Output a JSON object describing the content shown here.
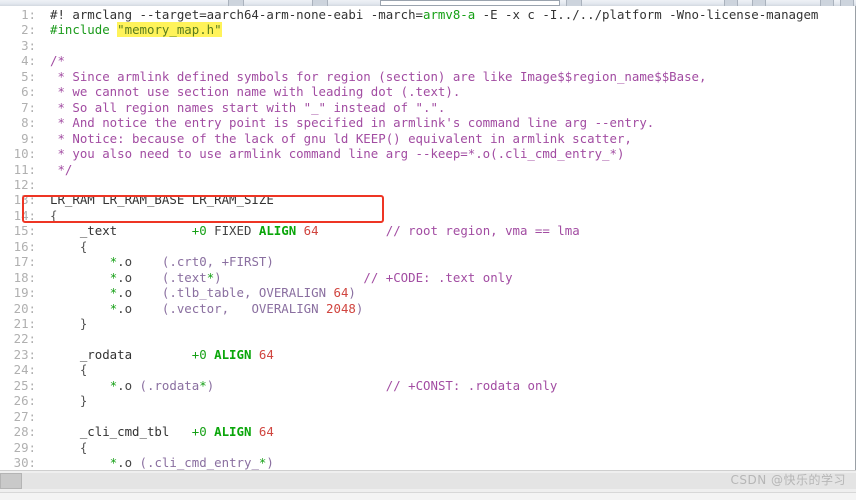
{
  "app": {
    "watermark": "CSDN @快乐的学习"
  },
  "toolbar": {
    "visible": true,
    "note": "clipped toolbar strip"
  },
  "editor": {
    "first_line_number": 1,
    "last_line_number": 30,
    "gutter_color": "#b0b0b0",
    "background": "#ffffff",
    "search_highlight_color": "#fff35a",
    "annotation_box_color": "#ee3524"
  },
  "lines": [
    {
      "n": "1",
      "tokens": [
        {
          "t": "#! armclang --target=aarch64-arm-none-eabi -march=",
          "c": "t-plain"
        },
        {
          "t": "armv8-a",
          "c": "t-green"
        },
        {
          "t": " -E -x c -I../../platform -Wno-license-managem",
          "c": "t-plain"
        }
      ]
    },
    {
      "n": "2",
      "tokens": [
        {
          "t": "#include",
          "c": "t-pre"
        },
        {
          "t": " ",
          "c": "t-plain"
        },
        {
          "t": "\"memory_map.h\"",
          "c": "t-str t-hl"
        }
      ]
    },
    {
      "n": "3",
      "tokens": []
    },
    {
      "n": "4",
      "tokens": [
        {
          "t": "/*",
          "c": "t-comment"
        }
      ]
    },
    {
      "n": "5",
      "tokens": [
        {
          "t": " * Since armlink defined symbols for region (section) are like Image$$region_name$$Base,",
          "c": "t-comment"
        }
      ]
    },
    {
      "n": "6",
      "tokens": [
        {
          "t": " * we cannot use section name with leading dot (.text).",
          "c": "t-comment"
        }
      ]
    },
    {
      "n": "7",
      "tokens": [
        {
          "t": " * So all region names start with \"_\" instead of \".\".",
          "c": "t-comment"
        }
      ]
    },
    {
      "n": "8",
      "tokens": [
        {
          "t": " * And notice the entry point is specified in armlink's command line arg --entry.",
          "c": "t-comment"
        }
      ]
    },
    {
      "n": "9",
      "tokens": [
        {
          "t": " * Notice: because of the lack of gnu ld KEEP() equivalent in armlink scatter,",
          "c": "t-comment"
        }
      ]
    },
    {
      "n": "10",
      "tokens": [
        {
          "t": " * you also need to use armlink command line arg --keep=*.o(.cli_cmd_entry_*)",
          "c": "t-comment"
        }
      ]
    },
    {
      "n": "11",
      "tokens": [
        {
          "t": " */",
          "c": "t-comment"
        }
      ]
    },
    {
      "n": "12",
      "tokens": []
    },
    {
      "n": "13",
      "tokens": [
        {
          "t": "LR_RAM ",
          "c": "t-plain"
        },
        {
          "t": "LR_RAM_BASE LR_RAM_SIZE",
          "c": "t-red"
        }
      ]
    },
    {
      "n": "14",
      "tokens": [
        {
          "t": "{",
          "c": "t-bk"
        }
      ]
    },
    {
      "n": "15",
      "tokens": [
        {
          "t": "    _text          ",
          "c": "t-plain"
        },
        {
          "t": "+0",
          "c": "t-green"
        },
        {
          "t": " FIXED ",
          "c": "t-dark"
        },
        {
          "t": "ALIGN",
          "c": "t-kw"
        },
        {
          "t": " ",
          "c": "t-plain"
        },
        {
          "t": "64",
          "c": "t-num"
        },
        {
          "t": "         ",
          "c": "t-plain"
        },
        {
          "t": "// root region, vma == lma",
          "c": "t-comment"
        }
      ]
    },
    {
      "n": "16",
      "tokens": [
        {
          "t": "    {",
          "c": "t-bk"
        }
      ]
    },
    {
      "n": "17",
      "tokens": [
        {
          "t": "        ",
          "c": "t-plain"
        },
        {
          "t": "*",
          "c": "t-green"
        },
        {
          "t": ".o",
          "c": "t-dark"
        },
        {
          "t": "    ",
          "c": "t-plain"
        },
        {
          "t": "(.crt0, +FIRST)",
          "c": "t-paren"
        }
      ]
    },
    {
      "n": "18",
      "tokens": [
        {
          "t": "        ",
          "c": "t-plain"
        },
        {
          "t": "*",
          "c": "t-green"
        },
        {
          "t": ".o",
          "c": "t-dark"
        },
        {
          "t": "    ",
          "c": "t-plain"
        },
        {
          "t": "(.text",
          "c": "t-paren"
        },
        {
          "t": "*",
          "c": "t-green"
        },
        {
          "t": ")",
          "c": "t-paren"
        },
        {
          "t": "                   ",
          "c": "t-plain"
        },
        {
          "t": "// +CODE: .text only",
          "c": "t-comment"
        }
      ]
    },
    {
      "n": "19",
      "tokens": [
        {
          "t": "        ",
          "c": "t-plain"
        },
        {
          "t": "*",
          "c": "t-green"
        },
        {
          "t": ".o",
          "c": "t-dark"
        },
        {
          "t": "    ",
          "c": "t-plain"
        },
        {
          "t": "(.tlb_table, OVERALIGN ",
          "c": "t-paren"
        },
        {
          "t": "64",
          "c": "t-num"
        },
        {
          "t": ")",
          "c": "t-paren"
        }
      ]
    },
    {
      "n": "20",
      "tokens": [
        {
          "t": "        ",
          "c": "t-plain"
        },
        {
          "t": "*",
          "c": "t-green"
        },
        {
          "t": ".o",
          "c": "t-dark"
        },
        {
          "t": "    ",
          "c": "t-plain"
        },
        {
          "t": "(.vector,   OVERALIGN ",
          "c": "t-paren"
        },
        {
          "t": "2048",
          "c": "t-num"
        },
        {
          "t": ")",
          "c": "t-paren"
        }
      ]
    },
    {
      "n": "21",
      "tokens": [
        {
          "t": "    }",
          "c": "t-bk"
        }
      ]
    },
    {
      "n": "22",
      "tokens": []
    },
    {
      "n": "23",
      "tokens": [
        {
          "t": "    _rodata        ",
          "c": "t-plain"
        },
        {
          "t": "+0",
          "c": "t-green"
        },
        {
          "t": " ",
          "c": "t-plain"
        },
        {
          "t": "ALIGN",
          "c": "t-kw"
        },
        {
          "t": " ",
          "c": "t-plain"
        },
        {
          "t": "64",
          "c": "t-num"
        }
      ]
    },
    {
      "n": "24",
      "tokens": [
        {
          "t": "    {",
          "c": "t-bk"
        }
      ]
    },
    {
      "n": "25",
      "tokens": [
        {
          "t": "        ",
          "c": "t-plain"
        },
        {
          "t": "*",
          "c": "t-green"
        },
        {
          "t": ".o ",
          "c": "t-dark"
        },
        {
          "t": "(.rodata",
          "c": "t-paren"
        },
        {
          "t": "*",
          "c": "t-green"
        },
        {
          "t": ")",
          "c": "t-paren"
        },
        {
          "t": "                       ",
          "c": "t-plain"
        },
        {
          "t": "// +CONST: .rodata only",
          "c": "t-comment"
        }
      ]
    },
    {
      "n": "26",
      "tokens": [
        {
          "t": "    }",
          "c": "t-bk"
        }
      ]
    },
    {
      "n": "27",
      "tokens": []
    },
    {
      "n": "28",
      "tokens": [
        {
          "t": "    _cli_cmd_tbl   ",
          "c": "t-plain"
        },
        {
          "t": "+0",
          "c": "t-green"
        },
        {
          "t": " ",
          "c": "t-plain"
        },
        {
          "t": "ALIGN",
          "c": "t-kw"
        },
        {
          "t": " ",
          "c": "t-plain"
        },
        {
          "t": "64",
          "c": "t-num"
        }
      ]
    },
    {
      "n": "29",
      "tokens": [
        {
          "t": "    {",
          "c": "t-bk"
        }
      ]
    },
    {
      "n": "30",
      "tokens": [
        {
          "t": "        ",
          "c": "t-plain"
        },
        {
          "t": "*",
          "c": "t-green"
        },
        {
          "t": ".o ",
          "c": "t-dark"
        },
        {
          "t": "(.cli_cmd_entry_",
          "c": "t-paren"
        },
        {
          "t": "*",
          "c": "t-green"
        },
        {
          "t": ")",
          "c": "t-paren"
        }
      ]
    }
  ]
}
